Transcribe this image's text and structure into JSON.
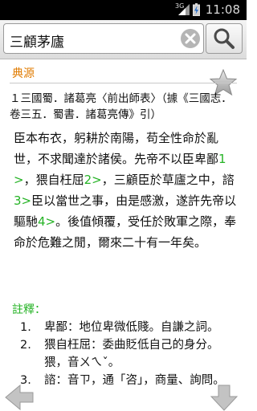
{
  "status_bar": {
    "network": "3G",
    "time": "11:08"
  },
  "search": {
    "query": "三顧茅廬"
  },
  "section": {
    "title": "典源"
  },
  "source": {
    "text": "１三國蜀．諸葛亮〈前出師表〉（據《三國志．卷三五．蜀書．諸葛亮傳》引）"
  },
  "main": {
    "seg1": "臣本布衣，躬耕於南陽，苟全性命於亂世，不求聞達於諸侯。先帝不以臣卑鄙",
    "ref1": "1>",
    "seg2": "，猥自枉屈",
    "ref2": "2>",
    "seg3": "，三顧臣於草廬之中，諮",
    "ref3": "3>",
    "seg4": "臣以當世之事，由是感激，遂許先帝以驅馳",
    "ref4": "4>",
    "seg5": "。後值傾覆，受任於敗軍之際，奉命於危難之閒，爾來二十有一年矣。"
  },
  "notes": {
    "title": "註釋：",
    "items": [
      {
        "num": "1.",
        "text": "卑鄙：地位卑微低賤。自謙之詞。"
      },
      {
        "num": "2.",
        "text": "猥自枉屈：委曲貶低自己的身分。猥，音ㄨㄟˇ。"
      },
      {
        "num": "3.",
        "text": "諮：音ㄗ，通「咨」，商量、詢問。"
      }
    ]
  },
  "colors": {
    "accent_orange": "#e07b00",
    "link_green": "#25b325"
  },
  "icons": [
    "signal-icon",
    "battery-icon",
    "clear-icon",
    "search-icon",
    "star-icon",
    "arrow-left-icon",
    "arrow-down-icon"
  ]
}
